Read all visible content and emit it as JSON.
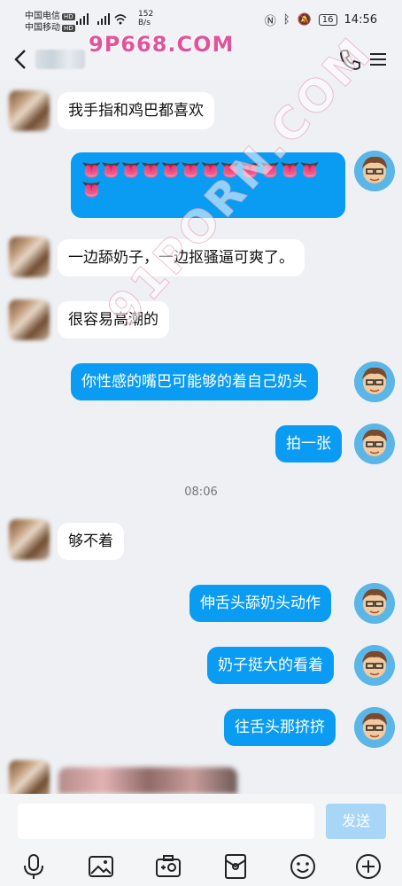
{
  "status_bar": {
    "carrier1": "中国电信",
    "carrier2": "中国移动",
    "hd": "HD",
    "net_speed": "152",
    "net_unit": "B/s",
    "battery": "16",
    "time": "14:56"
  },
  "watermark": {
    "top": "9P668.COM",
    "diagonal": "91PORN.COM"
  },
  "messages": [
    {
      "side": "in",
      "text": "我手指和鸡巴都喜欢"
    },
    {
      "side": "out",
      "text": "👅👅👅👅👅👅👅👅👅👅👅👅",
      "text2": "👅"
    },
    {
      "side": "in",
      "text": "一边舔奶子，一边抠骚逼可爽了。"
    },
    {
      "side": "in",
      "text": "很容易高潮的"
    },
    {
      "side": "out",
      "text": "你性感的嘴巴可能够的着自己奶头"
    },
    {
      "side": "out",
      "text": "拍一张"
    },
    {
      "side": "in",
      "text": "够不着"
    },
    {
      "side": "out",
      "text": "伸舌头舔奶头动作"
    },
    {
      "side": "out",
      "text": "奶子挺大的看着"
    },
    {
      "side": "out",
      "text": "往舌头那挤挤"
    }
  ],
  "timestamp": "08:06",
  "input": {
    "send_label": "发送"
  },
  "colors": {
    "accent": "#0a9cf3",
    "send_disabled": "#a8d6f6",
    "background": "#eef0f4"
  },
  "icons": [
    "back-arrow-icon",
    "phone-icon",
    "menu-icon",
    "voice-icon",
    "image-icon",
    "camera-icon",
    "red-packet-icon",
    "emoji-icon",
    "add-icon"
  ]
}
